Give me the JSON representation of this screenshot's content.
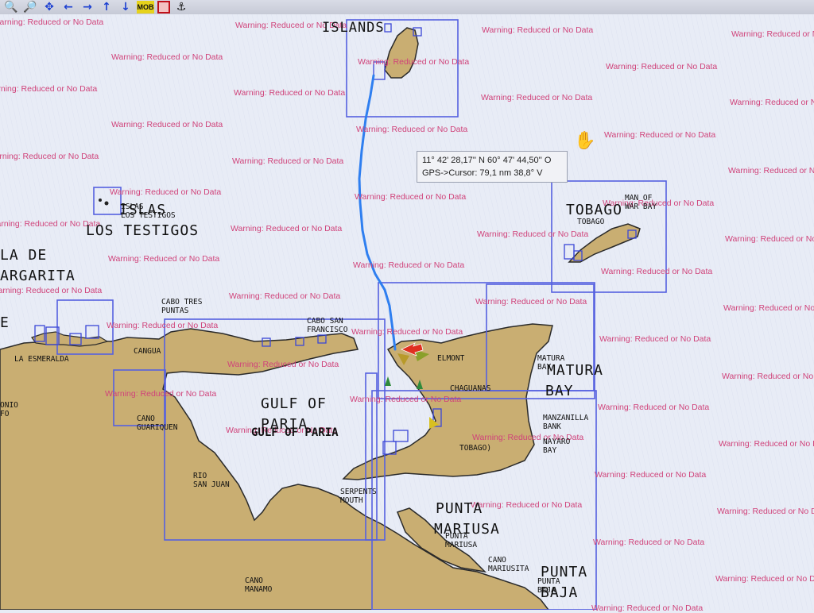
{
  "toolbar": {
    "buttons": [
      "zoom-in",
      "zoom-out",
      "pan",
      "arrow-left",
      "arrow-right",
      "arrow-up",
      "arrow-down"
    ],
    "mob_label": "MOB"
  },
  "cursor_info": {
    "line1": "11° 42' 28,17'' N 60° 47' 44,50'' O",
    "line2": "GPS->Cursor: 79,1 nm   38,8° V"
  },
  "warning_text": "Warning: Reduced or No Data",
  "labels": {
    "islands": "ISLANDS",
    "islas_1": "ISLAS",
    "islas_2": "LOS TESTIGOS",
    "islas_small": "ISLAS\nLOS TESTIGOS",
    "la_de": "LA DE",
    "argarita": "ARGARITA",
    "e": "E",
    "tobago": "TOBAGO",
    "tobago_small": "TOBAGO",
    "man_of_war": "MAN OF\nWAR BAY",
    "gulf_of_paria_1": "GULF OF",
    "gulf_of_paria_2": "PARIA",
    "gulf_of_paria_3": "GULF OF PARIA",
    "cabo_tres_puntas": "CABO TRES\nPUNTAS",
    "cabo_san_francisco": "CABO SAN\nFRANCISCO",
    "cangua": "CANGUA",
    "la_esmeralda": "LA ESMERALDA",
    "onio": "ONIO\nFO",
    "cano_guariquen": "CANO\nGUARIQUEN",
    "rio_san_juan": "RIO\nSAN JUAN",
    "serpents_mouth": "SERPENTS\nMOUTH",
    "elmont": "ELMONT",
    "chaguanas": "CHAGUANAS",
    "matura_small": "MATURA\nBAY",
    "matura_big_1": "MATURA",
    "matura_big_2": "BAY",
    "manzanilla": "MANZANILLA\nBANK",
    "nayaro": "NAYARO\nBAY",
    "tobago_trin": "TOBAGO)",
    "punta_mariusa_1": "PUNTA",
    "punta_mariusa_2": "MARIUSA",
    "punta_mariusa_small": "PUNTA\nMARIUSA",
    "cano_mariusita": "CANO\nMARIUSITA",
    "punta_baja_1": "PUNTA",
    "punta_baja_2": "BAJA",
    "punta_baja_small": "PUNTA\nBAJA",
    "cano_manamo": "CANO\nMANAMO"
  },
  "colors": {
    "land": "#c9ae72",
    "coast": "#2a2a2a",
    "sea": "#e8ecf6",
    "chart_box": "#5560e0",
    "track": "#2f7ff0",
    "warning": "#d0437a",
    "boat": "#e03020"
  }
}
